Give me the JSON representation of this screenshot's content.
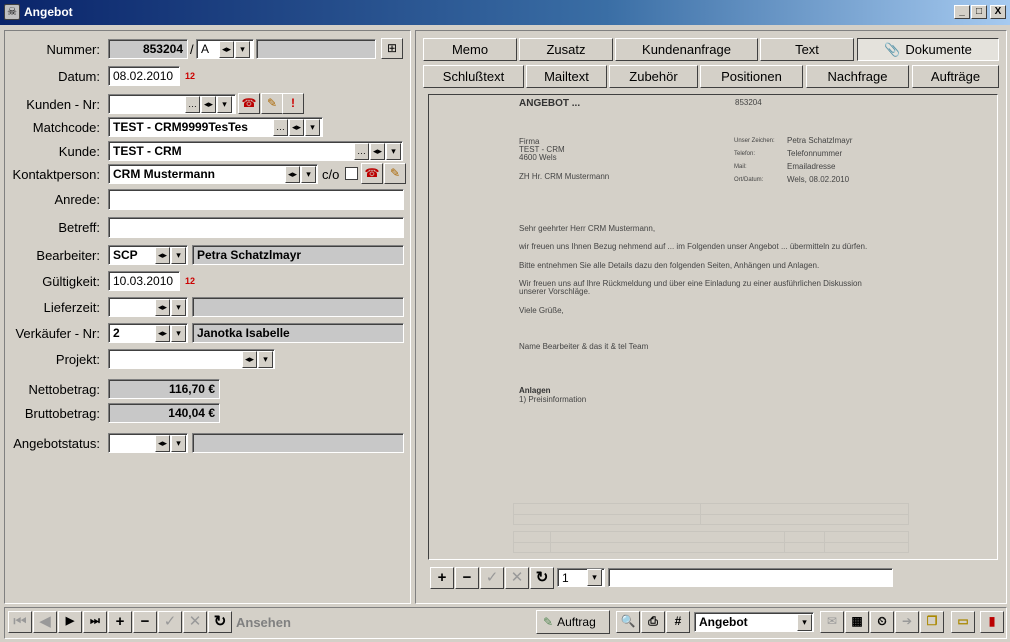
{
  "window": {
    "title": "Angebot",
    "controls": [
      "_",
      "□",
      "X"
    ]
  },
  "form": {
    "nummer_label": "Nummer:",
    "nummer_value": "853204",
    "nummer_sep": "/",
    "nummer_suffix": "A",
    "datum_label": "Datum:",
    "datum_value": "08.02.2010",
    "kunden_nr_label": "Kunden - Nr:",
    "kunden_nr_value": "",
    "matchcode_label": "Matchcode:",
    "matchcode_value": "TEST - CRM9999TesTes",
    "kunde_label": "Kunde:",
    "kunde_value": "TEST - CRM",
    "kontakt_label": "Kontaktperson:",
    "kontakt_value": "CRM Mustermann",
    "co_label": "c/o",
    "anrede_label": "Anrede:",
    "anrede_value": "",
    "betreff_label": "Betreff:",
    "betreff_value": "",
    "bearbeiter_label": "Bearbeiter:",
    "bearbeiter_code": "SCP",
    "bearbeiter_name": "Petra Schatzlmayr",
    "gueltigkeit_label": "Gültigkeit:",
    "gueltigkeit_value": "10.03.2010",
    "lieferzeit_label": "Lieferzeit:",
    "lieferzeit_value": "",
    "verkaeufer_label": "Verkäufer - Nr:",
    "verkaeufer_code": "2",
    "verkaeufer_name": "Janotka Isabelle",
    "projekt_label": "Projekt:",
    "projekt_value": "",
    "netto_label": "Nettobetrag:",
    "netto_value": "116,70 €",
    "brutto_label": "Bruttobetrag:",
    "brutto_value": "140,04 €",
    "status_label": "Angebotstatus:",
    "status_value": "",
    "calendar_icon_text": "12"
  },
  "tabs_row1": [
    "Memo",
    "Zusatz",
    "Kundenanfrage",
    "Text",
    "Dokumente"
  ],
  "tabs_row2": [
    "Schlußtext",
    "Mailtext",
    "Zubehör",
    "Positionen",
    "Nachfrage",
    "Aufträge"
  ],
  "active_tab": "Dokumente",
  "document": {
    "heading": "ANGEBOT ...",
    "number": "853204",
    "firma_lines": [
      "Firma",
      "TEST - CRM",
      "4600 Wels"
    ],
    "attention": "ZH Hr. CRM Mustermann",
    "meta_labels": [
      "Unser Zeichen:",
      "Telefon:",
      "Mail:",
      "Ort/Datum:"
    ],
    "meta_values": [
      "Petra Schatzlmayr",
      "Telefonnummer",
      "Emailadresse",
      "Wels, 08.02.2010"
    ],
    "salutation": "Sehr geehrter Herr CRM Mustermann,",
    "body1": "wir freuen uns Ihnen Bezug nehmend auf ... im Folgenden unser Angebot ... übermitteln zu dürfen.",
    "body2": "Bitte entnehmen Sie alle Details dazu den folgenden Seiten, Anhängen und Anlagen.",
    "body3a": "Wir freuen uns auf Ihre Rückmeldung und über eine Einladung zu einer ausführlichen Diskussion",
    "body3b": "unserer Vorschläge.",
    "closing": "Viele Grüße,",
    "signature": "Name Bearbeiter & das it & tel Team",
    "anlagen_heading": "Anlagen",
    "anlagen_item": "1) Preisinformation"
  },
  "doc_toolbar": {
    "page_value": "1",
    "text_value": ""
  },
  "bottom_bar": {
    "ansehen_label": "Ansehen",
    "auftrag_label": "Auftrag",
    "type_value": "Angebot"
  }
}
